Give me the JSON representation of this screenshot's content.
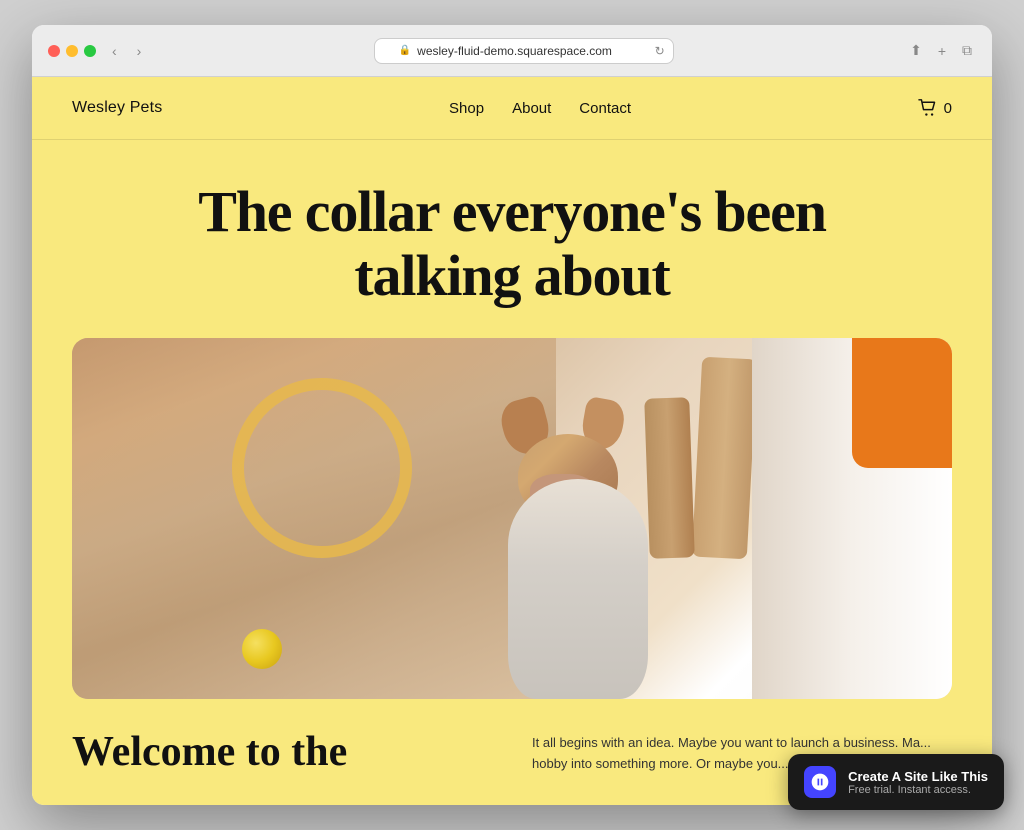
{
  "browser": {
    "url": "wesley-fluid-demo.squarespace.com",
    "reload_label": "↻"
  },
  "site": {
    "logo": "Wesley Pets",
    "nav": {
      "shop": "Shop",
      "about": "About",
      "contact": "Contact"
    },
    "cart_count": "0",
    "hero": {
      "headline_line1": "The collar everyone's been",
      "headline_line2": "talking about"
    },
    "below_fold": {
      "welcome_headline_line1": "Welcome to the",
      "body_text": "It all begins with an idea. Maybe you want to launch a business. Ma... hobby into something more. Or maybe you..."
    }
  },
  "cta": {
    "title": "Create A Site Like This",
    "subtitle": "Free trial. Instant access.",
    "icon_label": "squarespace-icon"
  }
}
